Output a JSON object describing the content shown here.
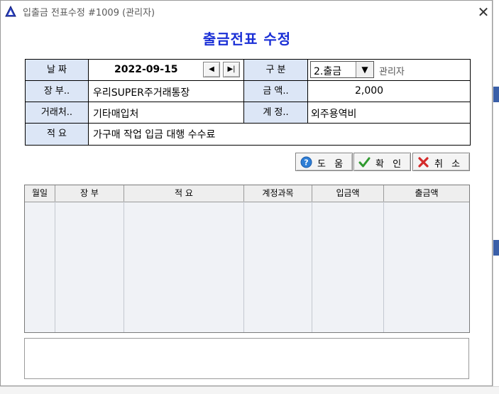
{
  "window": {
    "title": "입출금 전표수정 #1009 (관리자)",
    "close_label": "✕"
  },
  "heading": "출금전표 수정",
  "form": {
    "date_label": "날 짜",
    "date_value": "2022-09-15",
    "prev_label": "◀",
    "next_label": "▶|",
    "type_label": "구 분",
    "type_value": "2.출금",
    "user_value": "관리자",
    "account_book_label": "장 부..",
    "account_book_value": "우리SUPER주거래통장",
    "amount_label": "금 액..",
    "amount_value": "2,000",
    "vendor_label": "거래처..",
    "vendor_value": "기타매입처",
    "ledger_label": "계 정..",
    "ledger_value": "외주용역비",
    "memo_label": "적 요",
    "memo_value": "가구매 작업 입금 대행 수수료"
  },
  "buttons": {
    "help": "도 움",
    "ok": "확 인",
    "cancel": "취 소"
  },
  "grid": {
    "columns": [
      "월일",
      "장 부",
      "적 요",
      "계정과목",
      "입금액",
      "출금액"
    ]
  },
  "colors": {
    "heading": "#1a2fd6",
    "label_bg": "#dce6f6"
  }
}
